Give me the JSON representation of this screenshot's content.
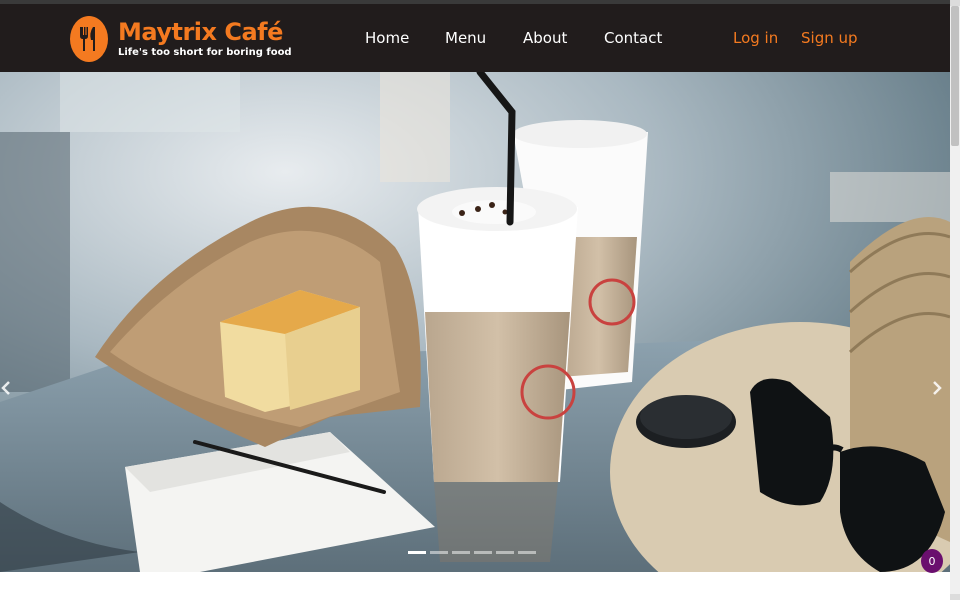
{
  "brand": {
    "name": "Maytrix Café",
    "tagline": "Life's too short for boring food",
    "logo_icon": "fork-knife-icon",
    "accent": "#f47a20"
  },
  "nav": {
    "items": [
      {
        "label": "Home"
      },
      {
        "label": "Menu"
      },
      {
        "label": "About"
      },
      {
        "label": "Contact"
      }
    ],
    "login_label": "Log in",
    "signup_label": "Sign up"
  },
  "carousel": {
    "prev_icon": "chevron-left-icon",
    "next_icon": "chevron-right-icon",
    "slide_count": 6,
    "active_slide": 1
  },
  "chat": {
    "badge_count": "0",
    "color": "#6a0f6e"
  },
  "colors": {
    "navbar_bg": "#211c1c",
    "accent": "#f47a20",
    "nav_text": "#ffffff"
  }
}
